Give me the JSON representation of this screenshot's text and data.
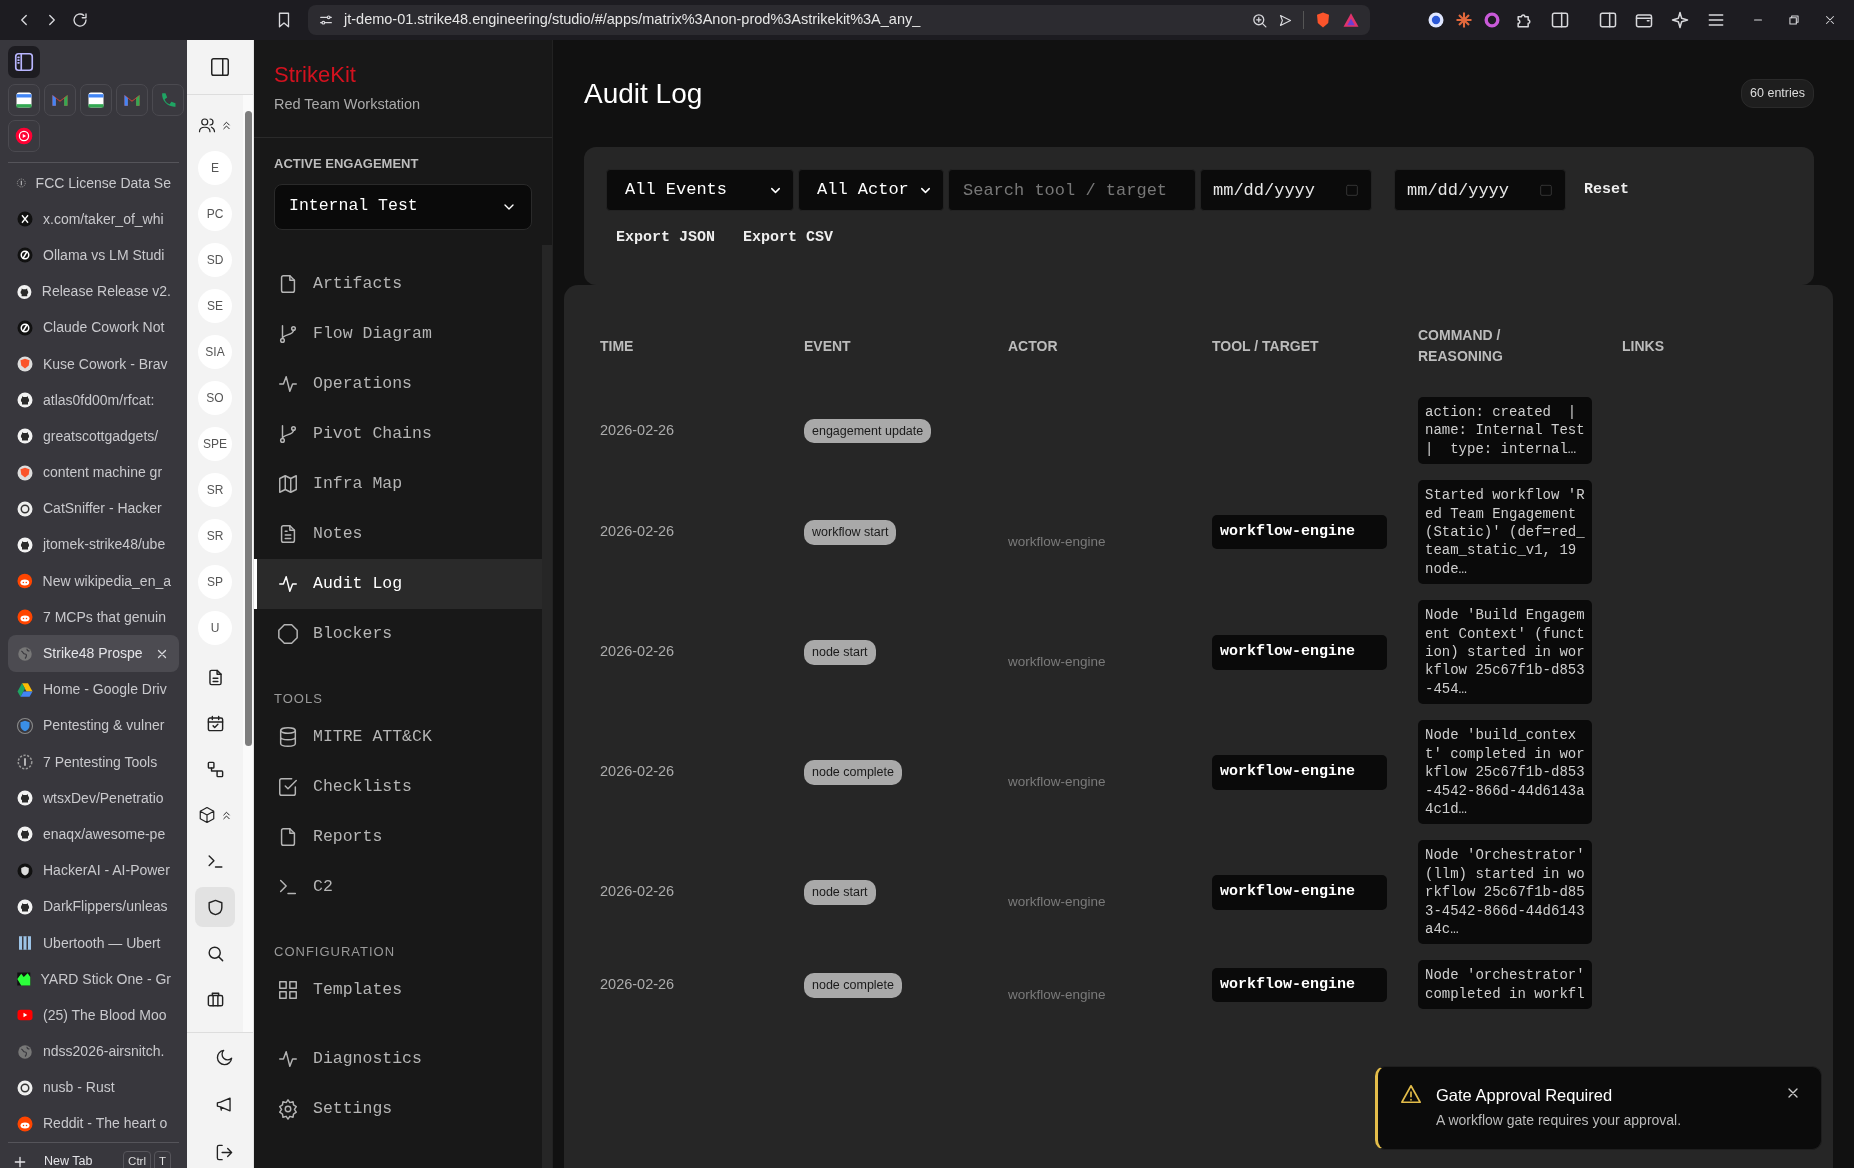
{
  "browser": {
    "url": "jt-demo-01.strike48.engineering/studio/#/apps/matrix%3Anon-prod%3Astrikekit%3A_any_"
  },
  "tabs": [
    {
      "title": "FCC License Data Se",
      "kind": "generic",
      "selected": false
    },
    {
      "title": "x.com/taker_of_whi",
      "kind": "x",
      "selected": false
    },
    {
      "title": "Ollama vs LM Studi",
      "kind": "ring",
      "selected": false
    },
    {
      "title": "Release Release v2.",
      "kind": "github",
      "selected": false
    },
    {
      "title": "Claude Cowork Not",
      "kind": "ring",
      "selected": false
    },
    {
      "title": "Kuse Cowork - Brav",
      "kind": "brave",
      "selected": false
    },
    {
      "title": "atlas0fd00m/rfcat:",
      "kind": "github",
      "selected": false
    },
    {
      "title": "greatscottgadgets/",
      "kind": "github",
      "selected": false
    },
    {
      "title": "content machine gr",
      "kind": "brave",
      "selected": false
    },
    {
      "title": "CatSniffer - Hacker",
      "kind": "rust",
      "selected": false
    },
    {
      "title": "jtomek-strike48/ube",
      "kind": "github",
      "selected": false
    },
    {
      "title": "New wikipedia_en_a",
      "kind": "reddit",
      "selected": false
    },
    {
      "title": "7 MCPs that genuin",
      "kind": "reddit",
      "selected": false
    },
    {
      "title": "Strike48 Prospe",
      "kind": "globe",
      "selected": true
    },
    {
      "title": "Home - Google Driv",
      "kind": "drive",
      "selected": false
    },
    {
      "title": "Pentesting & vulner",
      "kind": "shield",
      "selected": false
    },
    {
      "title": "7 Pentesting Tools",
      "kind": "generic",
      "selected": false
    },
    {
      "title": "wtsxDev/Penetratio",
      "kind": "github",
      "selected": false
    },
    {
      "title": "enaqx/awesome-pe",
      "kind": "github",
      "selected": false
    },
    {
      "title": "HackerAI - AI-Power",
      "kind": "hacker",
      "selected": false
    },
    {
      "title": "DarkFlippers/unleas",
      "kind": "github",
      "selected": false
    },
    {
      "title": "Ubertooth — Ubert",
      "kind": "bars",
      "selected": false
    },
    {
      "title": "YARD Stick One - Gr",
      "kind": "green",
      "selected": false
    },
    {
      "title": "(25) The Blood Moo",
      "kind": "youtube",
      "selected": false
    },
    {
      "title": "ndss2026-airsnitch.",
      "kind": "globe",
      "selected": false
    },
    {
      "title": "nusb - Rust",
      "kind": "rust",
      "selected": false
    },
    {
      "title": "Reddit - The heart o",
      "kind": "reddit",
      "selected": false
    }
  ],
  "new_tab": {
    "label": "New Tab",
    "keys": [
      "Ctrl",
      "T"
    ]
  },
  "rail": {
    "engagements": [
      "E",
      "PC",
      "SD",
      "SE",
      "SIA",
      "SO",
      "SPE",
      "SR",
      "SR",
      "SP",
      "U"
    ],
    "tools": [
      {
        "kind": "document",
        "selected": false
      },
      {
        "kind": "calendar",
        "selected": false
      },
      {
        "kind": "nodes",
        "selected": false
      },
      {
        "kind": "cube",
        "selected": false
      },
      {
        "kind": "terminal",
        "selected": false
      },
      {
        "kind": "shield",
        "selected": true
      },
      {
        "kind": "search",
        "selected": false
      },
      {
        "kind": "briefcase",
        "selected": false
      }
    ]
  },
  "app": {
    "brand": "StrikeKit",
    "subtitle": "Red Team Workstation",
    "engagement_label": "ACTIVE ENGAGEMENT",
    "engagement": "Internal Test"
  },
  "nav_groups": [
    {
      "items": [
        {
          "label": "Artifacts",
          "kind": "file",
          "selected": false
        },
        {
          "label": "Flow Diagram",
          "kind": "branch",
          "selected": false
        },
        {
          "label": "Operations",
          "kind": "pulse",
          "selected": false
        },
        {
          "label": "Pivot Chains",
          "kind": "branch",
          "selected": false
        },
        {
          "label": "Infra Map",
          "kind": "map",
          "selected": false
        },
        {
          "label": "Notes",
          "kind": "notes",
          "selected": false
        },
        {
          "label": "Audit Log",
          "kind": "pulse",
          "selected": true
        },
        {
          "label": "Blockers",
          "kind": "octagon",
          "selected": false
        }
      ]
    },
    {
      "heading": "TOOLS",
      "items": [
        {
          "label": "MITRE ATT&CK",
          "kind": "database",
          "selected": false
        },
        {
          "label": "Checklists",
          "kind": "check",
          "selected": false
        },
        {
          "label": "Reports",
          "kind": "file",
          "selected": false
        },
        {
          "label": "C2",
          "kind": "terminal",
          "selected": false
        }
      ]
    },
    {
      "heading": "CONFIGURATION",
      "items": [
        {
          "label": "Templates",
          "kind": "grid",
          "selected": false
        }
      ]
    },
    {
      "items": [
        {
          "label": "Diagnostics",
          "kind": "pulse",
          "selected": false
        },
        {
          "label": "Settings",
          "kind": "gear",
          "selected": false
        }
      ]
    }
  ],
  "page": {
    "title": "Audit Log",
    "count": "60 entries"
  },
  "filters": {
    "event": "All Events",
    "actor": "All Actor",
    "search_placeholder": "Search tool / target",
    "date_from_placeholder": "mm/dd/yyyy",
    "date_to_placeholder": "mm/dd/yyyy",
    "reset": "Reset",
    "exports": [
      "Export JSON",
      "Export CSV"
    ]
  },
  "table": {
    "columns": [
      "TIME",
      "EVENT",
      "ACTOR",
      "TOOL / TARGET",
      "COMMAND / REASONING",
      "LINKS"
    ],
    "rows": [
      {
        "time": "2026-02-26",
        "event": "engagement update",
        "command": "action: created  |  name: Internal Test  |  type: internal…"
      },
      {
        "time": "2026-02-26",
        "event": "workflow start",
        "actor": "workflow-engine",
        "target": "workflow-engine",
        "command": "Started workflow 'Red Team Engagement (Static)' (def=red_team_static_v1, 19 node…"
      },
      {
        "time": "2026-02-26",
        "event": "node start",
        "actor": "workflow-engine",
        "target": "workflow-engine",
        "command": "Node 'Build Engagement Context' (function) started in workflow 25c67f1b-d853-454…"
      },
      {
        "time": "2026-02-26",
        "event": "node complete",
        "actor": "workflow-engine",
        "target": "workflow-engine",
        "command": "Node 'build_context' completed in workflow 25c67f1b-d853-4542-866d-44d6143a4c1d…"
      },
      {
        "time": "2026-02-26",
        "event": "node start",
        "actor": "workflow-engine",
        "target": "workflow-engine",
        "command": "Node 'Orchestrator' (llm) started in workflow 25c67f1b-d853-4542-866d-44d6143a4c…"
      },
      {
        "time": "2026-02-26",
        "event": "node complete",
        "actor": "workflow-engine",
        "target": "workflow-engine",
        "command": "Node 'orchestrator' completed in workfl"
      }
    ]
  },
  "toast": {
    "title": "Gate Approval Required",
    "message": "A workflow gate requires your approval."
  }
}
